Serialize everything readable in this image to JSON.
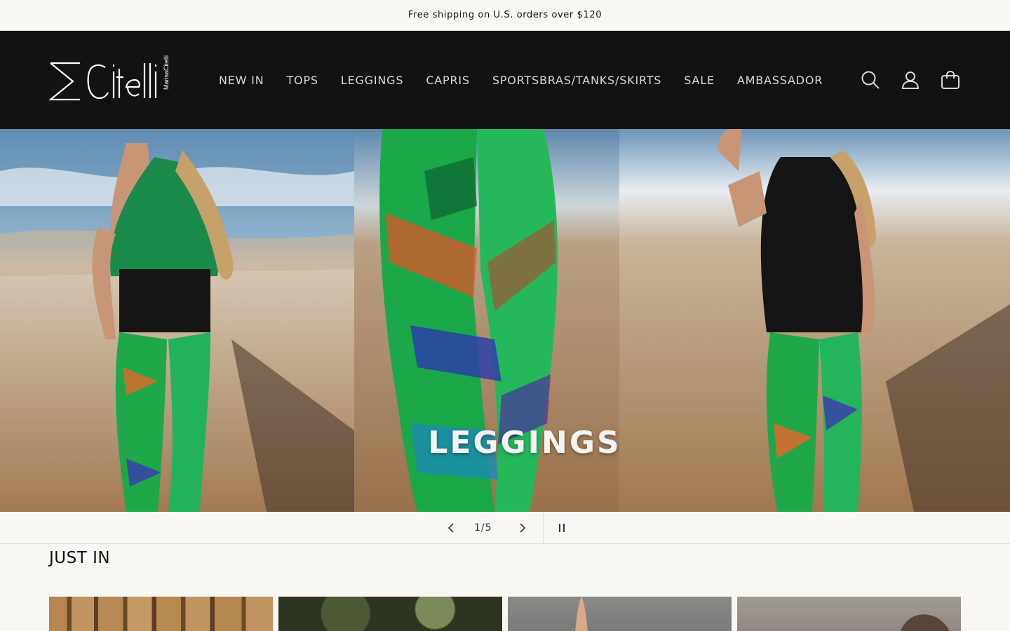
{
  "announcement": {
    "text": "Free shipping on U.S. orders over $120"
  },
  "header": {
    "logo_alt": "MarisaCitelli",
    "nav": [
      {
        "label": "NEW IN"
      },
      {
        "label": "TOPS"
      },
      {
        "label": "LEGGINGS"
      },
      {
        "label": "CAPRIS"
      },
      {
        "label": "SPORTSBRAS/TANKS/SKIRTS"
      },
      {
        "label": "SALE"
      },
      {
        "label": "AMBASSADOR"
      }
    ],
    "icons": [
      "search-icon",
      "account-icon",
      "cart-icon"
    ]
  },
  "hero": {
    "title": "LEGGINGS",
    "counter": "1/5"
  },
  "just_in": {
    "heading": "JUST IN"
  },
  "colors": {
    "header_bg": "#121212",
    "page_bg": "#f8f7f3",
    "nav_text": "#d9d9d9"
  }
}
